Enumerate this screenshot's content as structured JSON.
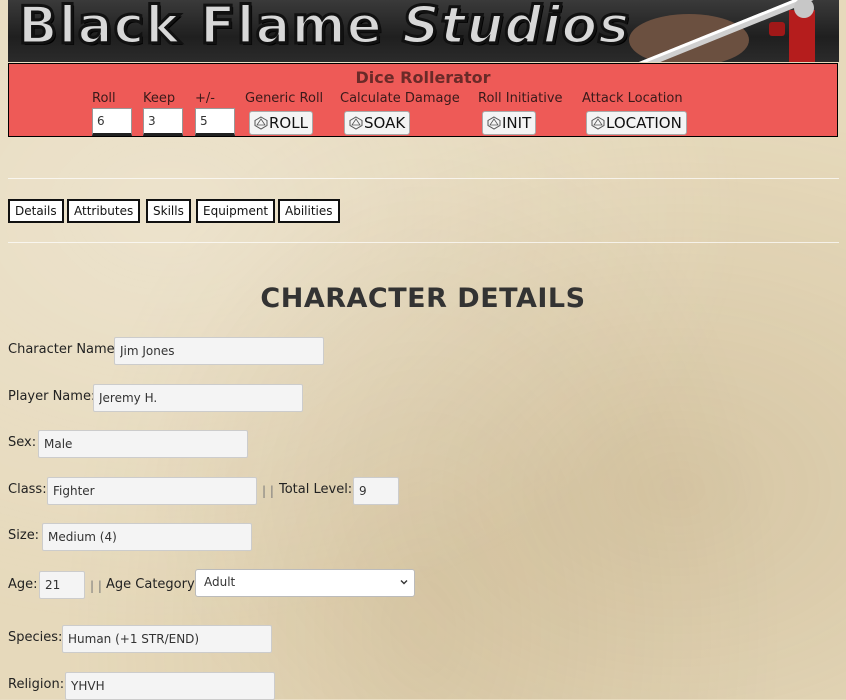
{
  "banner": {
    "title_part1": "Black Flame ",
    "title_part2": "Studios"
  },
  "roller": {
    "title": "Dice Rollerator",
    "roll_label": "Roll",
    "roll_value": "6",
    "keep_label": "Keep",
    "keep_value": "3",
    "mod_label": "+/-",
    "mod_value": "5",
    "generic_label": "Generic Roll",
    "generic_button": "ROLL",
    "damage_label": "Calculate Damage",
    "damage_button": "SOAK",
    "init_label": "Roll Initiative",
    "init_button": "INIT",
    "location_label": "Attack Location",
    "location_button": "LOCATION"
  },
  "tabs": [
    "Details",
    "Attributes",
    "Skills",
    "Equipment",
    "Abilities"
  ],
  "heading": "CHARACTER DETAILS",
  "fields": {
    "character_name": {
      "label": "Character Name:",
      "value": "Jim Jones"
    },
    "player_name": {
      "label": "Player Name:",
      "value": "Jeremy H."
    },
    "sex": {
      "label": "Sex:",
      "value": "Male"
    },
    "class": {
      "label": "Class:",
      "value": "Fighter"
    },
    "separator": "| |",
    "total_level": {
      "label": "Total Level:",
      "value": "9"
    },
    "size": {
      "label": "Size:",
      "value": "Medium (4)"
    },
    "age": {
      "label": "Age:",
      "value": "21"
    },
    "age_category": {
      "label": "Age Category:",
      "value": "Adult"
    },
    "species": {
      "label": "Species:",
      "value": "Human (+1 STR/END)"
    },
    "religion": {
      "label": "Religion:",
      "value": "YHVH"
    }
  },
  "icons": {
    "die": "d20-die-icon",
    "dropdown": "chevron-down-icon"
  },
  "colors": {
    "roller_bg": "#ee5a57",
    "parchment": "#e6d9bb"
  }
}
